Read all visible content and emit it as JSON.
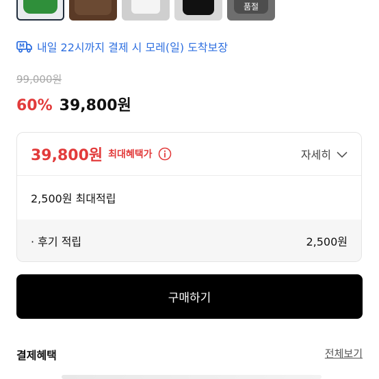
{
  "thumbnails": [
    {
      "color": "#2f8f3a",
      "selected": true
    },
    {
      "color": "#6b4a33"
    },
    {
      "color": "#f4f4f4"
    },
    {
      "color": "#111111"
    },
    {
      "color": "#4d4d4d",
      "badge": "품절"
    }
  ],
  "delivery": {
    "icon": "delivery-truck-icon",
    "text": "내일 22시까지 결제 시 모레(일) 도착보장",
    "color": "#2e6fe0"
  },
  "price": {
    "original": "99,000원",
    "discount": "60%",
    "sale": "39,800원",
    "discount_color": "#e23b3b"
  },
  "benefit": {
    "max_price": "39,800원",
    "max_label": "최대혜택가",
    "detail_label": "자세히",
    "points_label": "2,500원 최대적립",
    "review_label": "· 후기 적립",
    "review_value": "2,500원"
  },
  "buy_button": {
    "label": "구매하기"
  },
  "payment": {
    "title": "결제혜택",
    "see_all": "전체보기"
  }
}
